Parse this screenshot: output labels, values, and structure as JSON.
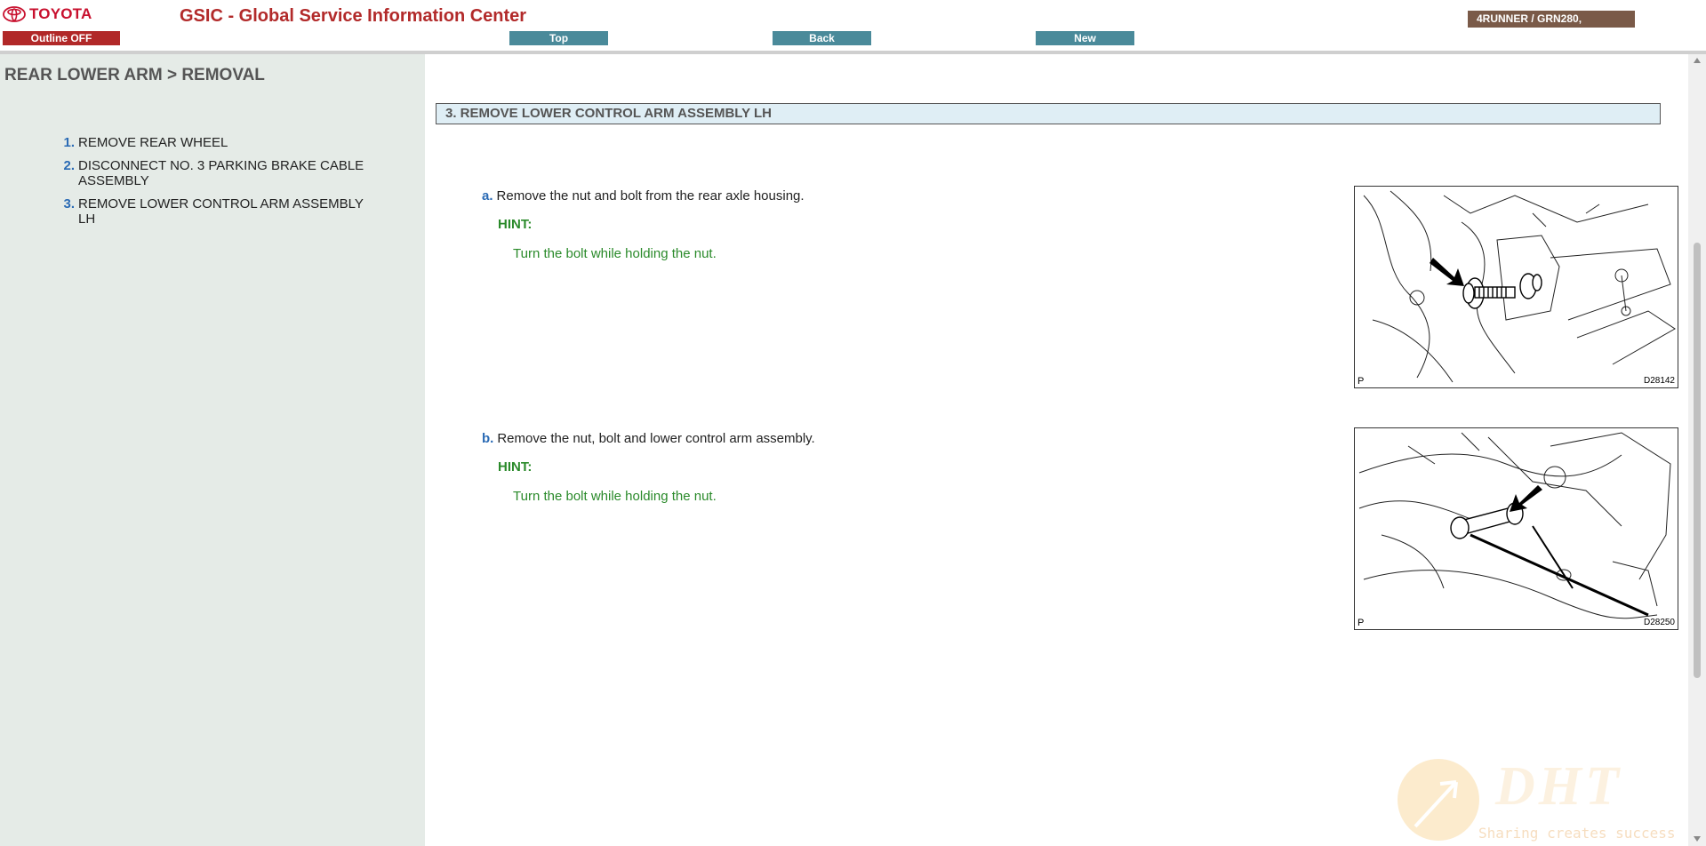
{
  "header": {
    "brand": "TOYOTA",
    "app_title": "GSIC - Global Service Information Center",
    "outline_button": "Outline OFF",
    "nav": {
      "top": "Top",
      "back": "Back",
      "new": "New"
    },
    "model": "4RUNNER / GRN280,"
  },
  "sidebar": {
    "title": "REAR LOWER ARM > REMOVAL",
    "items": [
      {
        "num": "1.",
        "label": "REMOVE REAR WHEEL"
      },
      {
        "num": "2.",
        "label": "DISCONNECT NO. 3 PARKING BRAKE CABLE ASSEMBLY"
      },
      {
        "num": "3.",
        "label": "REMOVE LOWER CONTROL ARM ASSEMBLY LH"
      }
    ]
  },
  "main": {
    "section_title": "3. REMOVE LOWER CONTROL ARM ASSEMBLY LH",
    "steps": [
      {
        "letter": "a.",
        "text": "Remove the nut and bolt from the rear axle housing.",
        "hint_label": "HINT:",
        "hint": "Turn the bolt while holding the nut.",
        "figure_p": "P",
        "figure_code": "D28142"
      },
      {
        "letter": "b.",
        "text": "Remove the nut, bolt and lower control arm assembly.",
        "hint_label": "HINT:",
        "hint": "Turn the bolt while holding the nut.",
        "figure_p": "P",
        "figure_code": "D28250"
      }
    ]
  },
  "watermark": {
    "brand": "DHT",
    "tagline": "Sharing creates success"
  },
  "colors": {
    "brand_red": "#c8102e",
    "nav_teal": "#4a8a9a",
    "hint_green": "#2a8a2a",
    "sidebar_bg": "#e5ebe7",
    "section_bg": "#dfeef5"
  },
  "icons": {
    "logo": "toyota-logo-icon",
    "arrow": "arrow-pointer-icon"
  }
}
